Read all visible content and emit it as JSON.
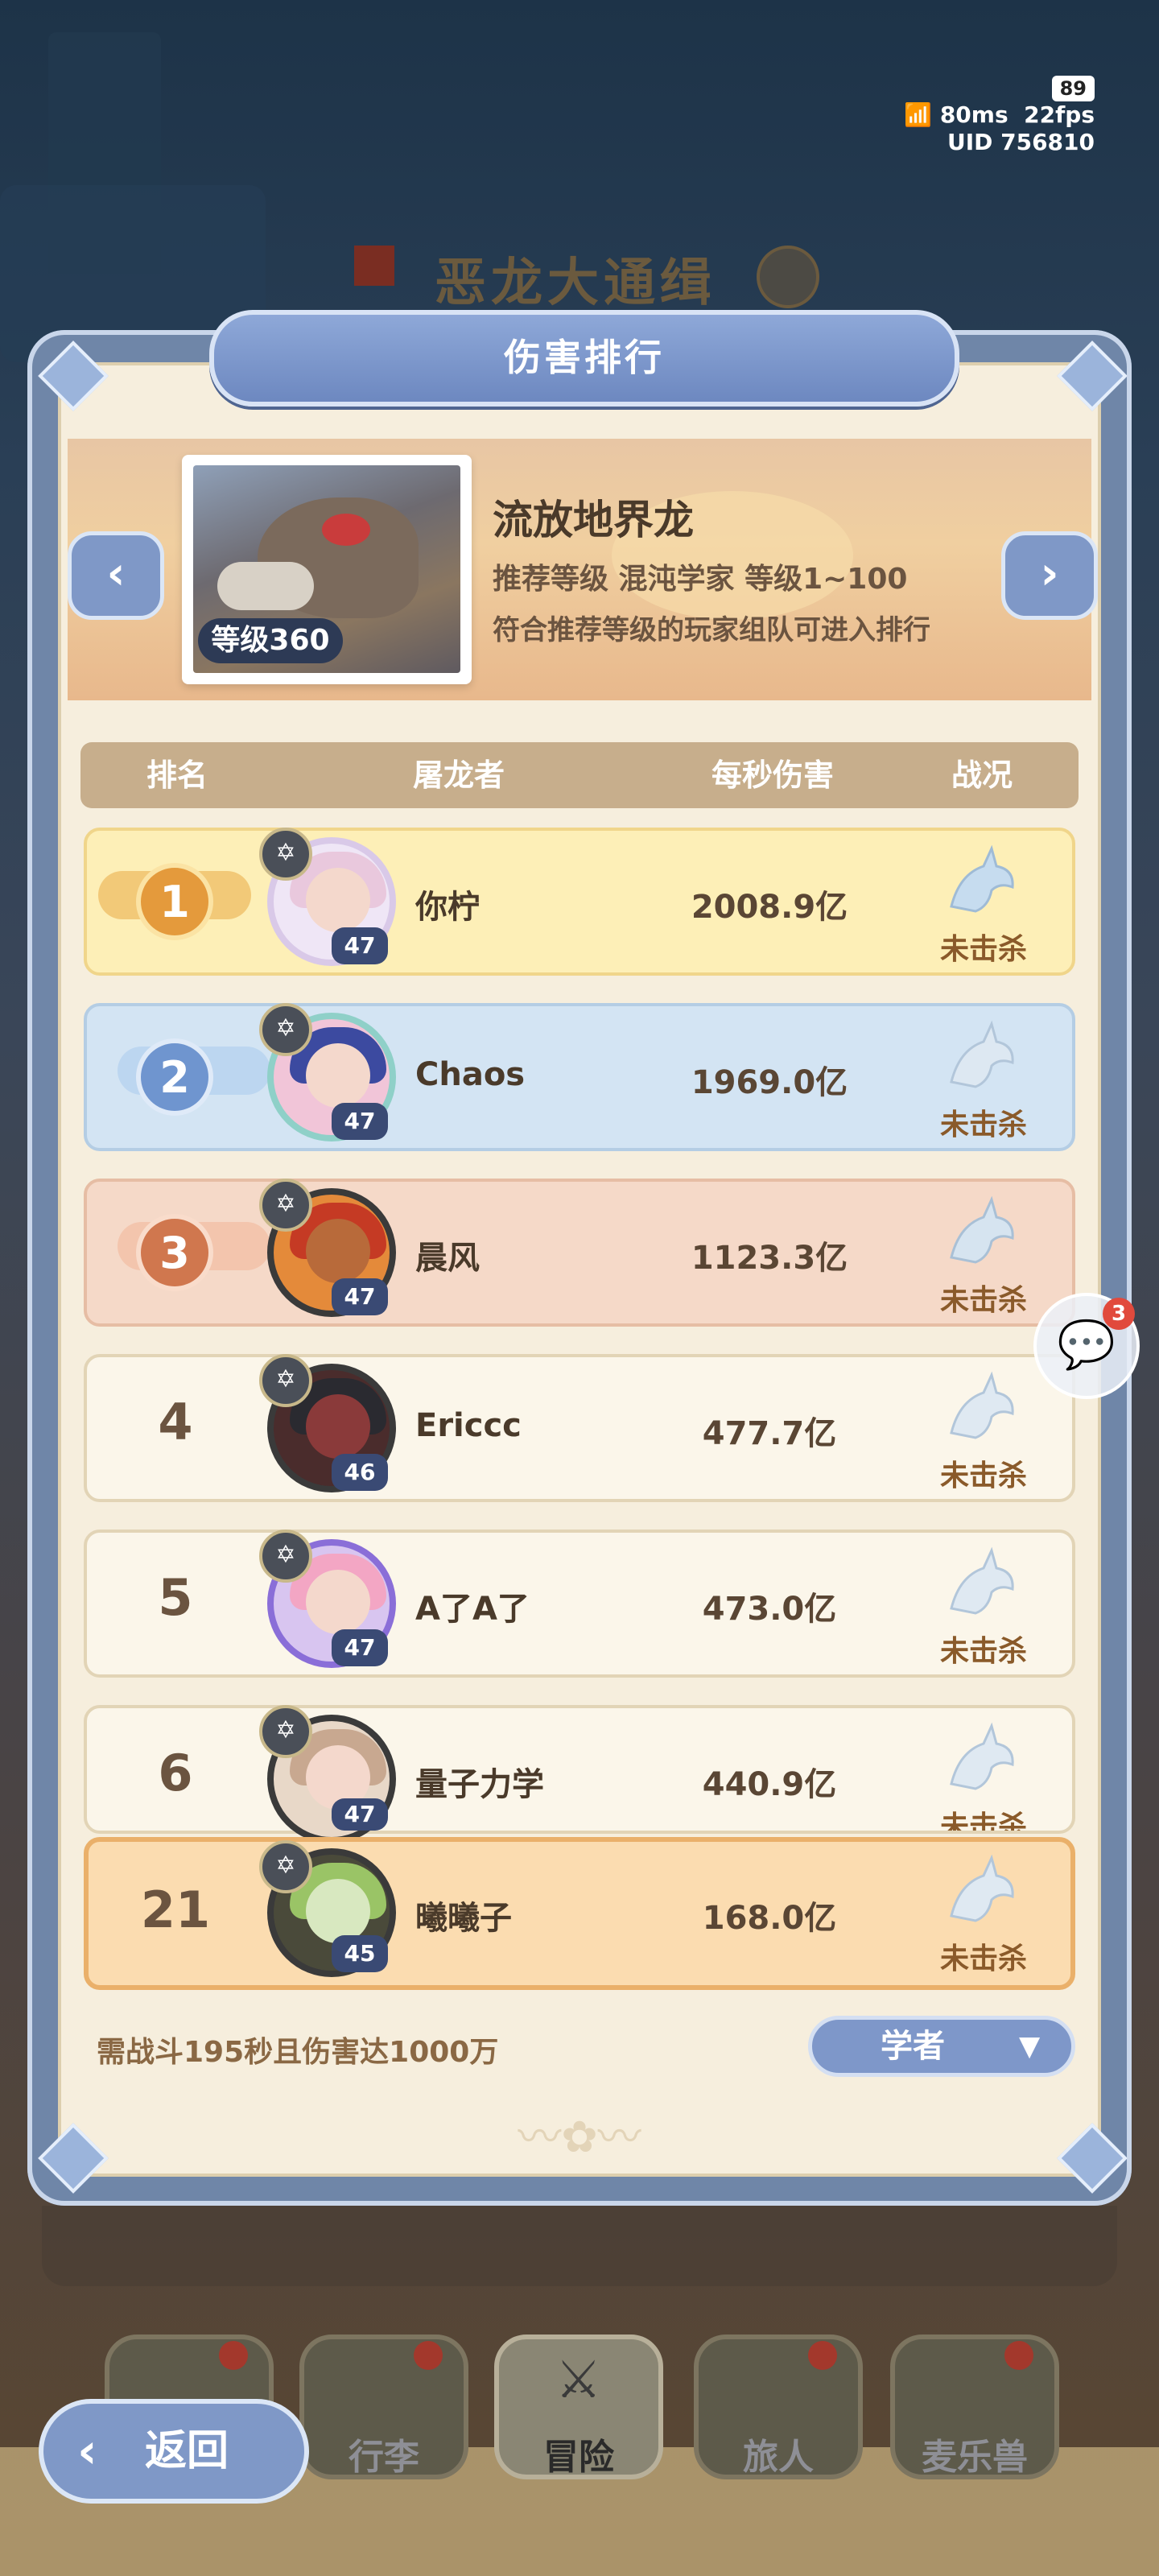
{
  "status": {
    "battery": "89",
    "ping": "80ms",
    "fps": "22fps",
    "uid": "UID 756810"
  },
  "background_title": "恶龙大通缉",
  "panel": {
    "title": "伤害排行"
  },
  "boss": {
    "level_label": "等级360",
    "name": "流放地界龙",
    "recommend": "推荐等级 混沌学家 等级1~100",
    "condition": "符合推荐等级的玩家组队可进入排行"
  },
  "table": {
    "headers": {
      "rank": "排名",
      "player": "屠龙者",
      "dps": "每秒伤害",
      "status": "战况"
    },
    "rows": [
      {
        "rank": "1",
        "name": "你柠",
        "level": "47",
        "dps": "2008.9亿",
        "status": "未击杀"
      },
      {
        "rank": "2",
        "name": "Chaos",
        "level": "47",
        "dps": "1969.0亿",
        "status": "未击杀"
      },
      {
        "rank": "3",
        "name": "晨风",
        "level": "47",
        "dps": "1123.3亿",
        "status": "未击杀"
      },
      {
        "rank": "4",
        "name": "Ericcc",
        "level": "46",
        "dps": "477.7亿",
        "status": "未击杀"
      },
      {
        "rank": "5",
        "name": "A了A了",
        "level": "47",
        "dps": "473.0亿",
        "status": "未击杀"
      },
      {
        "rank": "6",
        "name": "量子力学",
        "level": "47",
        "dps": "440.9亿",
        "status": "未击杀"
      }
    ],
    "self_row": {
      "rank": "21",
      "name": "曦曦子",
      "level": "45",
      "dps": "168.0亿",
      "status": "未击杀"
    }
  },
  "footer": {
    "requirement": "需战斗195秒且伤害达1000万",
    "filter": "学者"
  },
  "chat": {
    "badge": "3"
  },
  "bottom_nav": {
    "back": "返回",
    "items": [
      "行李",
      "冒险",
      "旅人",
      "麦乐兽"
    ]
  }
}
